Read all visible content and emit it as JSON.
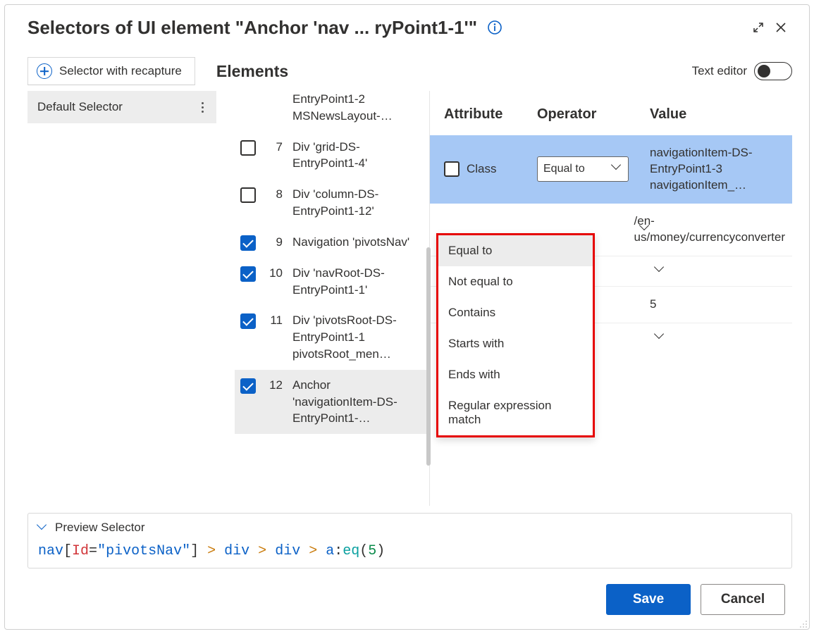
{
  "title": "Selectors of UI element \"Anchor 'nav ... ryPoint1-1'\"",
  "sidebar": {
    "recapture_label": "Selector with recapture",
    "items": [
      {
        "label": "Default Selector"
      }
    ]
  },
  "elements_heading": "Elements",
  "text_editor_label": "Text editor",
  "text_editor_on": false,
  "elements": [
    {
      "num": "",
      "checked": false,
      "label": "EntryPoint1-2 MSNewsLayout-…",
      "partial": true
    },
    {
      "num": "7",
      "checked": false,
      "label": "Div 'grid-DS-EntryPoint1-4'"
    },
    {
      "num": "8",
      "checked": false,
      "label": "Div 'column-DS-EntryPoint1-12'"
    },
    {
      "num": "9",
      "checked": true,
      "label": "Navigation 'pivotsNav'"
    },
    {
      "num": "10",
      "checked": true,
      "label": "Div 'navRoot-DS-EntryPoint1-1'"
    },
    {
      "num": "11",
      "checked": true,
      "label": "Div 'pivotsRoot-DS-EntryPoint1-1 pivotsRoot_men…"
    },
    {
      "num": "12",
      "checked": true,
      "label": "Anchor 'navigationItem-DS-EntryPoint1-…",
      "selected": true
    }
  ],
  "attrs": {
    "headers": {
      "attribute": "Attribute",
      "operator": "Operator",
      "value": "Value"
    },
    "rows": [
      {
        "attribute": "Class",
        "checked": false,
        "operator_open": true,
        "operator": "Equal to",
        "value": "navigationItem-DS-EntryPoint1-3 navigationItem_…",
        "highlight": true
      },
      {
        "value": "/en-us/money/currencyconverter",
        "operator_collapsed": true
      },
      {
        "operator_collapsed": true
      },
      {
        "value": "5"
      },
      {
        "operator_collapsed": true
      }
    ],
    "operator_options": [
      "Equal to",
      "Not equal to",
      "Contains",
      "Starts with",
      "Ends with",
      "Regular expression match"
    ]
  },
  "preview": {
    "label": "Preview Selector",
    "tokens": {
      "nav": "nav",
      "lb": "[",
      "id": "Id",
      "eq": "=",
      "q1": "\"",
      "val": "pivotsNav",
      "q2": "\"",
      "rb": "]",
      "gt1": " > ",
      "div1": "div",
      "gt2": " > ",
      "div2": "div",
      "gt3": " > ",
      "a": "a",
      "colon": ":",
      "eqfn": "eq",
      "lp": "(",
      "five": "5",
      "rp": ")"
    }
  },
  "buttons": {
    "save": "Save",
    "cancel": "Cancel"
  }
}
